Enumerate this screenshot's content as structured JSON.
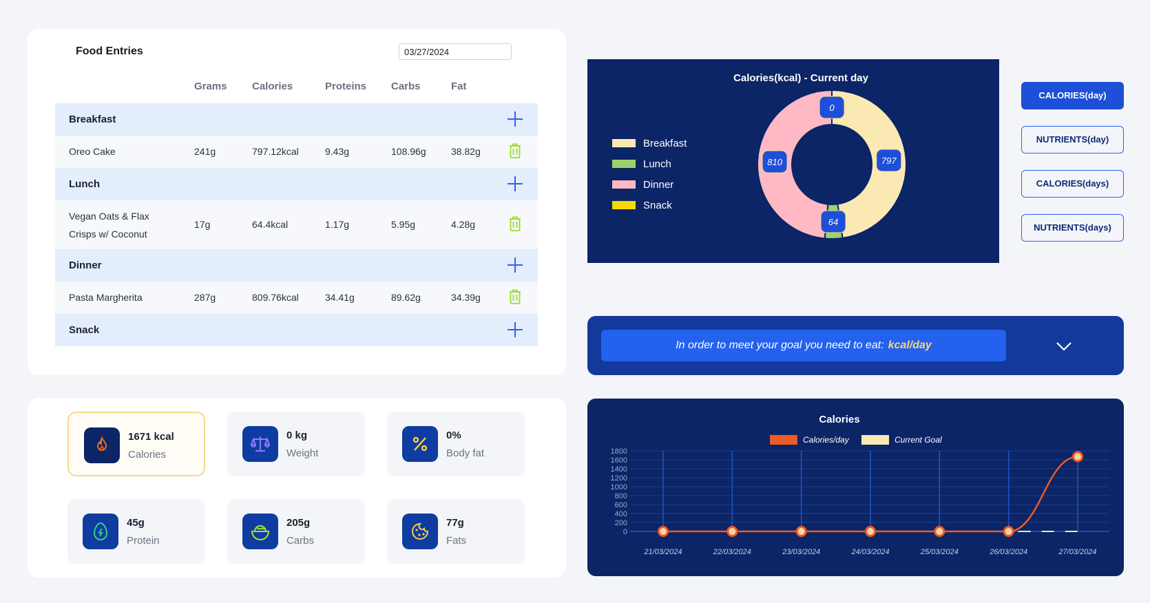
{
  "food_entries": {
    "title": "Food Entries",
    "date_value": "03/27/2024",
    "columns": [
      "Grams",
      "Calories",
      "Proteins",
      "Carbs",
      "Fat"
    ],
    "meals": [
      {
        "name": "Breakfast",
        "items": [
          {
            "name": "Oreo Cake",
            "grams": "241g",
            "calories": "797.12kcal",
            "proteins": "9.43g",
            "carbs": "108.96g",
            "fat": "38.82g"
          }
        ]
      },
      {
        "name": "Lunch",
        "items": [
          {
            "name": "Vegan Oats & Flax Crisps w/ Coconut",
            "grams": "17g",
            "calories": "64.4kcal",
            "proteins": "1.17g",
            "carbs": "5.95g",
            "fat": "4.28g"
          }
        ]
      },
      {
        "name": "Dinner",
        "items": [
          {
            "name": "Pasta Margherita",
            "grams": "287g",
            "calories": "809.76kcal",
            "proteins": "34.41g",
            "carbs": "89.62g",
            "fat": "34.39g"
          }
        ]
      },
      {
        "name": "Snack",
        "items": []
      }
    ]
  },
  "stats": [
    {
      "value": "1671 kcal",
      "label": "Calories",
      "icon": "flame-icon",
      "icon_color": "#f26a21"
    },
    {
      "value": "0 kg",
      "label": "Weight",
      "icon": "scale-icon",
      "icon_color": "#8b7bff"
    },
    {
      "value": "0%",
      "label": "Body fat",
      "icon": "percent-icon",
      "icon_color": "#f7d23e"
    },
    {
      "value": "45g",
      "label": "Protein",
      "icon": "egg-icon",
      "icon_color": "#35d07f"
    },
    {
      "value": "205g",
      "label": "Carbs",
      "icon": "bowl-icon",
      "icon_color": "#a6e22e"
    },
    {
      "value": "77g",
      "label": "Fats",
      "icon": "cookie-icon",
      "icon_color": "#f7d23e"
    }
  ],
  "view_buttons": [
    "CALORIES(day)",
    "NUTRIENTS(day)",
    "CALORIES(days)",
    "NUTRIENTS(days)"
  ],
  "goal": {
    "text": "In order to meet your goal you need to eat:",
    "unit": "kcal/day"
  },
  "colors": {
    "navy": "#0b2566",
    "accent_blue": "#2361ee",
    "breakfast": "#fbe9b3",
    "lunch": "#9bd26b",
    "dinner": "#ffb9c4",
    "snack": "#f5d900",
    "line": "#f15a22"
  },
  "chart_data": [
    {
      "type": "pie",
      "title": "Calories(kcal) - Current day",
      "categories": [
        "Breakfast",
        "Lunch",
        "Dinner",
        "Snack"
      ],
      "values": [
        797,
        64,
        810,
        0
      ],
      "legend_position": "left"
    },
    {
      "type": "line",
      "title": "Calories",
      "x": [
        "21/03/2024",
        "22/03/2024",
        "23/03/2024",
        "24/03/2024",
        "25/03/2024",
        "26/03/2024",
        "27/03/2024"
      ],
      "series": [
        {
          "name": "Calories/day",
          "values": [
            0,
            0,
            0,
            0,
            0,
            0,
            1671
          ]
        },
        {
          "name": "Current Goal",
          "values": [
            null,
            null,
            null,
            null,
            null,
            null,
            null
          ]
        }
      ],
      "ylim": [
        0,
        1800
      ],
      "yticks": [
        0,
        200,
        400,
        600,
        800,
        1000,
        1200,
        1400,
        1600,
        1800
      ],
      "legend_position": "top",
      "grid": true
    }
  ]
}
